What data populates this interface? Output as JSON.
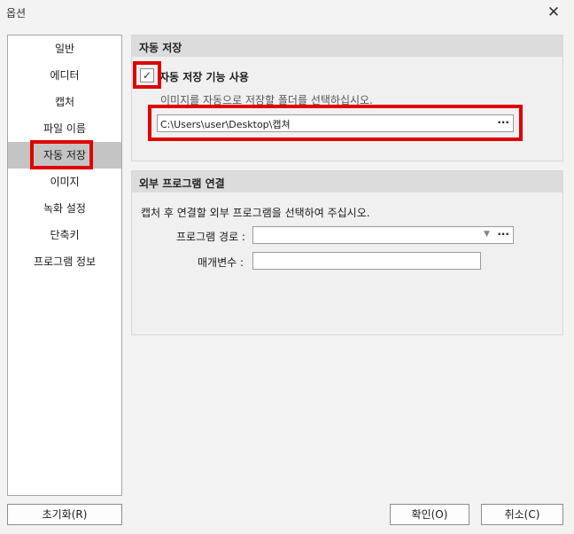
{
  "window": {
    "title": "옵션",
    "close_glyph": "✕"
  },
  "sidebar": {
    "items": [
      {
        "label": "일반"
      },
      {
        "label": "에디터"
      },
      {
        "label": "캡처"
      },
      {
        "label": "파일 이름"
      },
      {
        "label": "자동 저장",
        "selected": true
      },
      {
        "label": "이미지"
      },
      {
        "label": "녹화 설정"
      },
      {
        "label": "단축키"
      },
      {
        "label": "프로그램 정보"
      }
    ]
  },
  "autosave": {
    "section_title": "자동 저장",
    "checkbox_label": "자동 저장 기능 사용",
    "checkbox_checked": true,
    "checkmark": "✓",
    "hint": "이미지를 자동으로 저장할 폴더를 선택하십시오.",
    "folder_path": "C:\\Users\\user\\Desktop\\캡쳐",
    "browse_label": "···"
  },
  "external": {
    "section_title": "외부 프로그램 연결",
    "description": "캡처 후 연결할 외부 프로그램을 선택하여 주십시오.",
    "program_path_label": "프로그램 경로 :",
    "program_path_value": "",
    "dropdown_glyph": "▼",
    "browse_label": "···",
    "params_label": "매개변수 :",
    "params_value": ""
  },
  "footer": {
    "reset_label": "초기화(R)",
    "ok_label": "확인(O)",
    "cancel_label": "취소(C)"
  },
  "highlight_color": "#e00000"
}
